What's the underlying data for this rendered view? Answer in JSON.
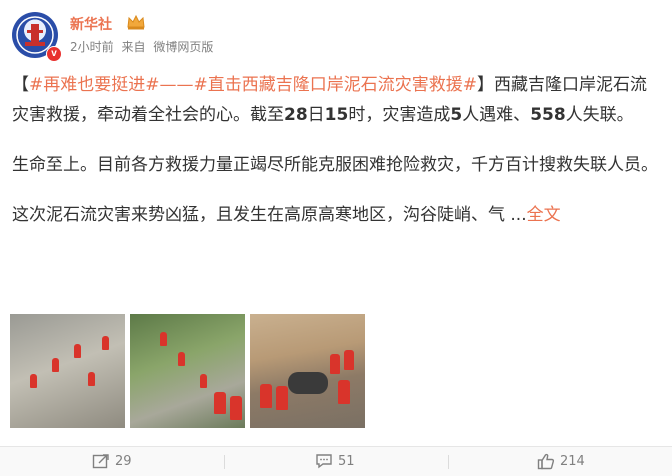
{
  "post": {
    "username": "新华社",
    "time": "2小时前",
    "source_prefix": "来自",
    "source": "微博网页版",
    "p1_bracket_open": "【",
    "topic1": "#再难也要挺进#",
    "dash": "——",
    "topic2": "#直击西藏吉隆口岸泥石流灾害救援#",
    "p1_bracket_close": "】",
    "p1_text_a": "西藏吉隆口岸泥石流灾害救援，牵动着全社会的心。截至",
    "p1_num_day": "28",
    "p1_text_b": "日",
    "p1_num_hour": "15",
    "p1_text_c": "时，灾害造成",
    "p1_num_dead": "5",
    "p1_text_d": "人遇难、",
    "p1_num_missing": "558",
    "p1_text_e": "人失联。",
    "p2": "生命至上。目前各方救援力量正竭尽所能克服困难抢险救灾，千方百计搜救失联人员。",
    "p3": "这次泥石流灾害来势凶猛，且发生在高原高寒地区，沟谷陡峭、气 ...",
    "more_label": "全文"
  },
  "footer": {
    "reposts": "29",
    "comments": "51",
    "likes": "214"
  },
  "colors": {
    "accent": "#eb7350",
    "text": "#333333",
    "meta": "#808080"
  },
  "icons": {
    "verified": "v",
    "repost": "repost-icon",
    "comment": "comment-icon",
    "like": "thumbs-up-icon"
  }
}
